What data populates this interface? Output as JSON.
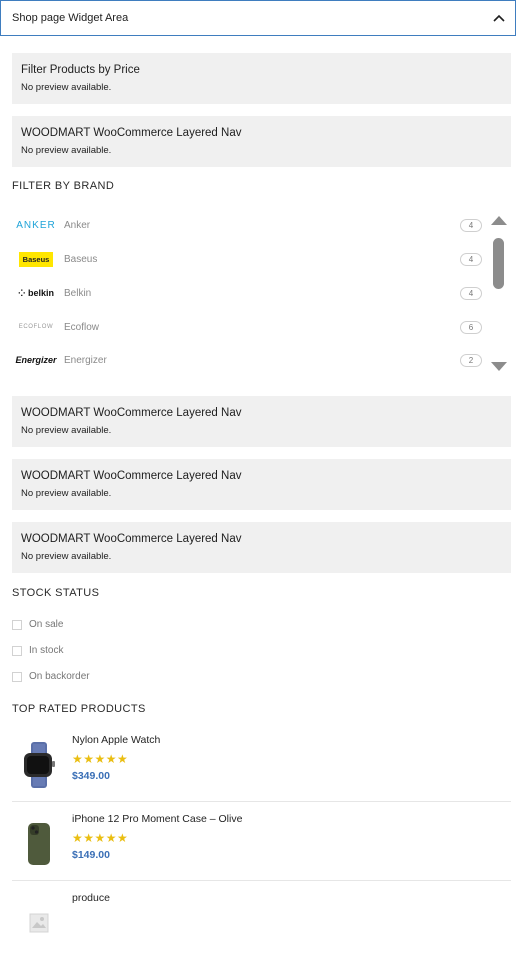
{
  "panel": {
    "title": "Shop page Widget Area"
  },
  "preview_boxes": [
    {
      "title": "Filter Products by Price",
      "note": "No preview available."
    },
    {
      "title": "WOODMART WooCommerce Layered Nav",
      "note": "No preview available."
    },
    {
      "title": "WOODMART WooCommerce Layered Nav",
      "note": "No preview available."
    },
    {
      "title": "WOODMART WooCommerce Layered Nav",
      "note": "No preview available."
    },
    {
      "title": "WOODMART WooCommerce Layered Nav",
      "note": "No preview available."
    }
  ],
  "filter_by_brand": {
    "heading": "FILTER BY BRAND",
    "brands": [
      {
        "name": "Anker",
        "count": "4",
        "logo": "ANKER"
      },
      {
        "name": "Baseus",
        "count": "4",
        "logo": "Baseus"
      },
      {
        "name": "Belkin",
        "count": "4",
        "logo": "belkin"
      },
      {
        "name": "Ecoflow",
        "count": "6",
        "logo": "ECOFLOW"
      },
      {
        "name": "Energizer",
        "count": "2",
        "logo": "Energizer"
      }
    ]
  },
  "stock_status": {
    "heading": "STOCK STATUS",
    "options": [
      "On sale",
      "In stock",
      "On backorder"
    ]
  },
  "top_rated": {
    "heading": "TOP RATED PRODUCTS",
    "products": [
      {
        "name": "Nylon Apple Watch",
        "stars": "★★★★★",
        "price": "$349.00",
        "thumb_icon": "apple-watch-icon"
      },
      {
        "name": "iPhone 12 Pro Moment Case – Olive",
        "stars": "★★★★★",
        "price": "$149.00",
        "thumb_icon": "phone-case-icon"
      },
      {
        "name": "produce",
        "stars": "",
        "price": "",
        "thumb_icon": "image-placeholder-icon"
      }
    ]
  },
  "colors": {
    "accent": "#3f7dbf",
    "star": "#eabe12",
    "price": "#3a6fb6",
    "preview_bg": "#f0f0f0"
  }
}
